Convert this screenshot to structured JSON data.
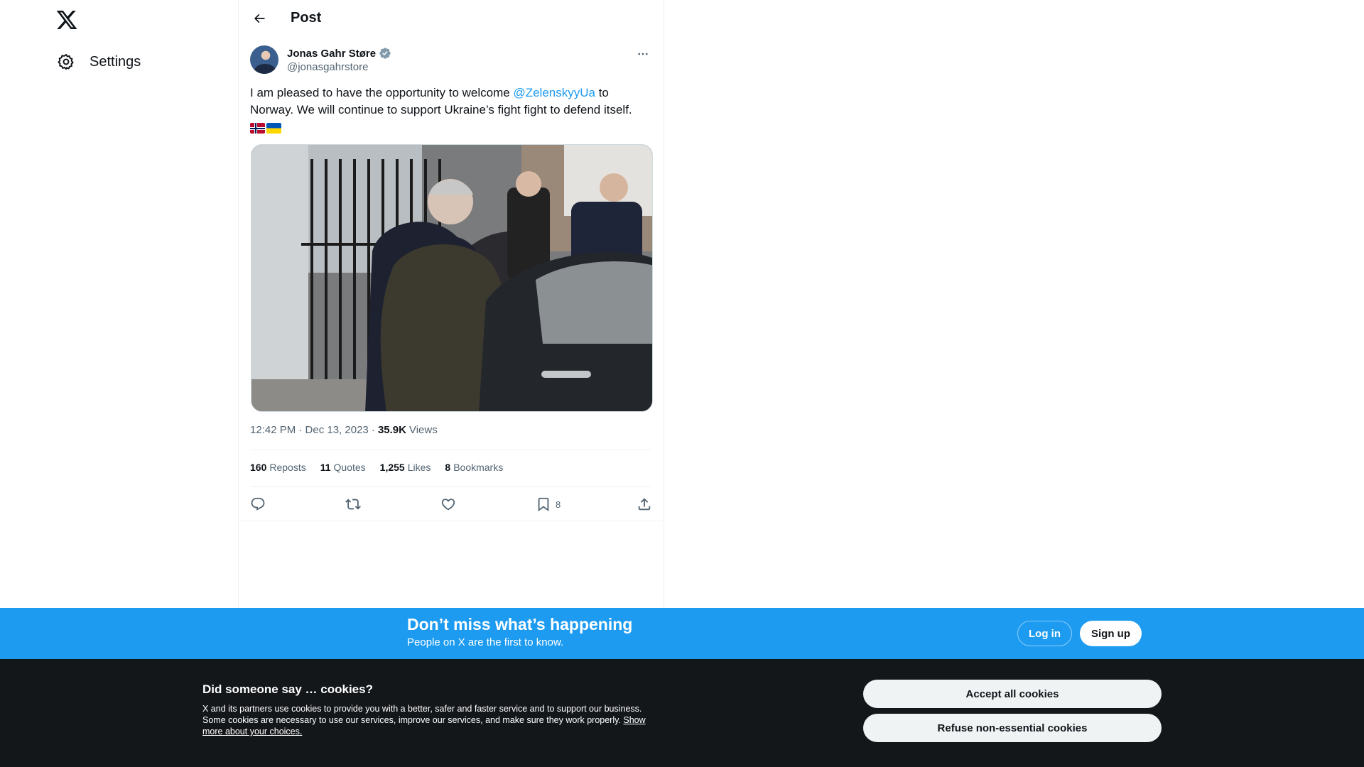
{
  "nav": {
    "logo": "x-logo",
    "settings_label": "Settings"
  },
  "header": {
    "title": "Post"
  },
  "post": {
    "author_name": "Jonas Gahr Støre",
    "author_handle": "@jonasgahrstore",
    "text_before": "I am pleased to have the opportunity to welcome ",
    "mention": "@ZelenskyyUa",
    "text_after": " to Norway. We will continue to support Ukraine’s fight fight to defend itself.",
    "flags": [
      "🇳🇴",
      "🇺🇦"
    ],
    "time": "12:42 PM · Dec 13, 2023 · ",
    "views_count": "35.9K",
    "views_label": "Views",
    "stats": [
      {
        "num": "160",
        "label": "Reposts"
      },
      {
        "num": "11",
        "label": "Quotes"
      },
      {
        "num": "1,255",
        "label": "Likes"
      },
      {
        "num": "8",
        "label": "Bookmarks"
      }
    ],
    "bookmark_count": "8"
  },
  "banner": {
    "heading": "Don’t miss what’s happening",
    "subtext": "People on X are the first to know.",
    "login_label": "Log in",
    "signup_label": "Sign up"
  },
  "cookie": {
    "heading": "Did someone say … cookies?",
    "body": "X and its partners use cookies to provide you with a better, safer and faster service and to support our business. Some cookies are necessary to use our services, improve our services, and make sure they work properly. ",
    "link": "Show more about your choices.",
    "accept_label": "Accept all cookies",
    "refuse_label": "Refuse non-essential cookies"
  },
  "colors": {
    "accent": "#1d9bf0",
    "text_primary": "#0f1419",
    "text_secondary": "#536471",
    "cookie_bg": "#14171a"
  }
}
